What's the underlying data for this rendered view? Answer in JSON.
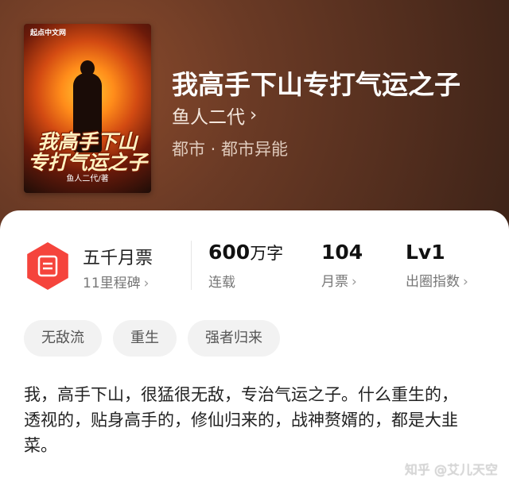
{
  "book": {
    "title": "我高手下山专打气运之子",
    "author": "鱼人二代",
    "author_chevron": "›",
    "genre": "都市 · 都市异能"
  },
  "cover": {
    "publisher": "起点中文网",
    "title_line1": "我高手下山",
    "title_line2": "专打气运之子",
    "author_credit": "鱼人二代/著"
  },
  "ticket": {
    "icon": "ticket-hexagon-icon",
    "title": "五千月票",
    "subtitle": "11里程碑",
    "chevron": "›"
  },
  "stats": [
    {
      "value": "600",
      "unit": "万字",
      "label": "连载",
      "chevron": ""
    },
    {
      "value": "104",
      "unit": "",
      "label": "月票",
      "chevron": "›"
    },
    {
      "value": "Lv1",
      "unit": "",
      "label": "出圈指数",
      "chevron": "›"
    }
  ],
  "tags": [
    "无敌流",
    "重生",
    "强者归来"
  ],
  "description": "我，高手下山，很猛很无敌，专治气运之子。什么重生的，透视的，贴身高手的，修仙归来的，战神赘婿的，都是大韭菜。",
  "watermark": "知乎 @艾儿天空",
  "colors": {
    "accent_red": "#f5443c",
    "header_brown": "#5b3320"
  }
}
